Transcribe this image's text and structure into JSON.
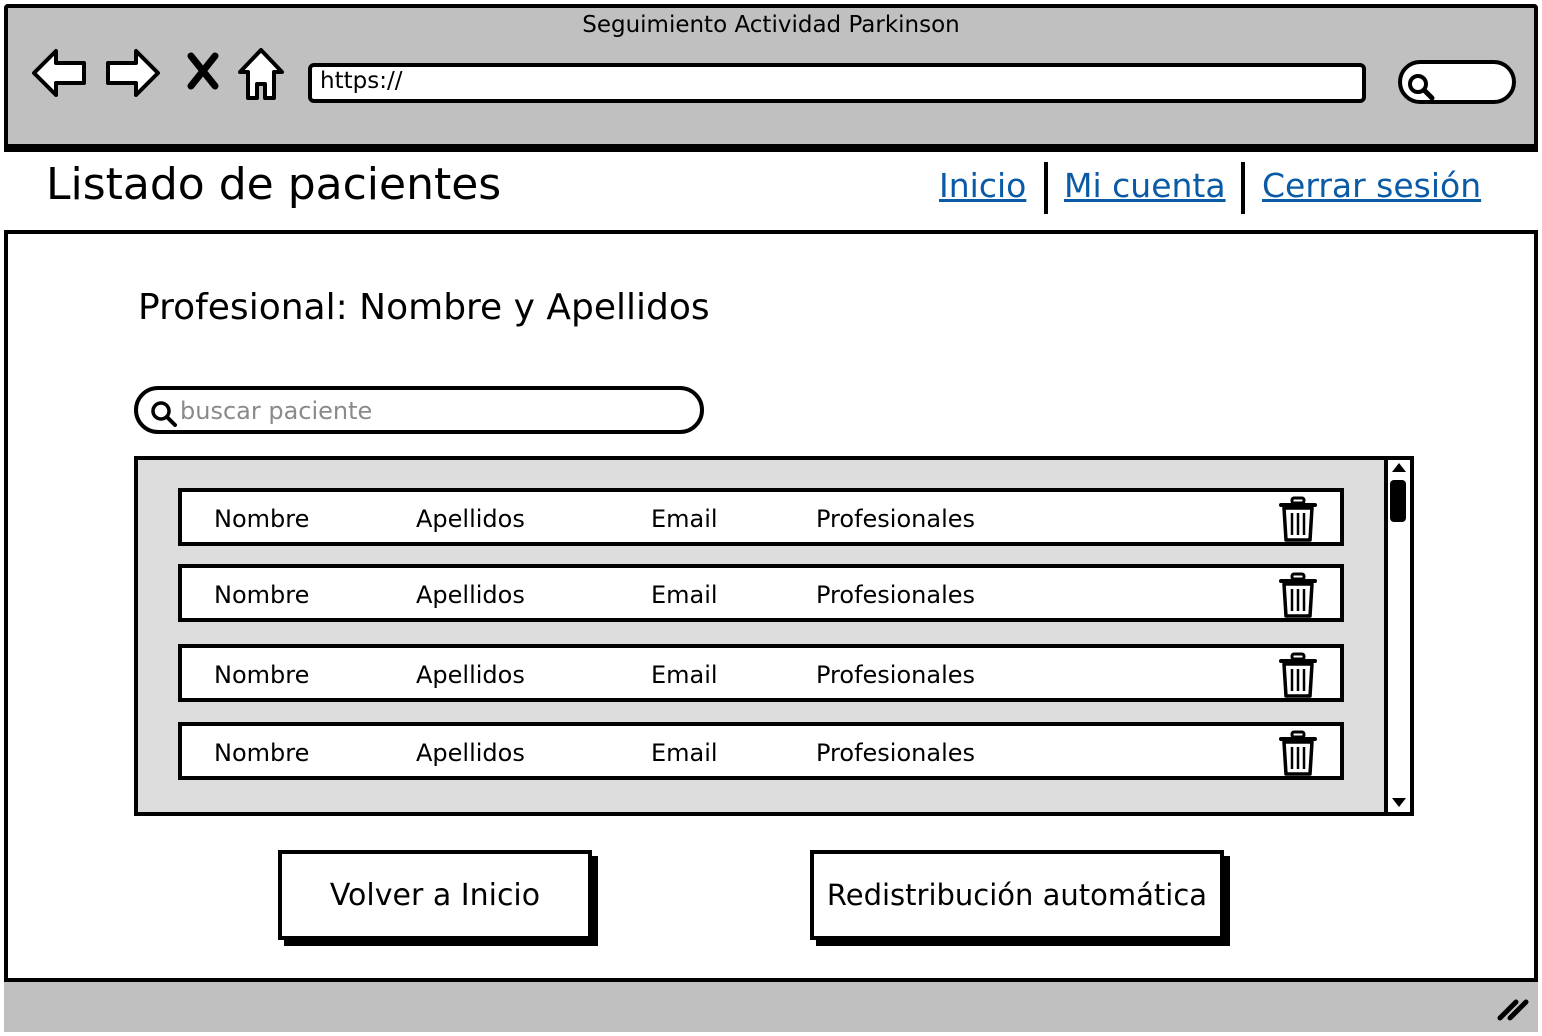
{
  "window": {
    "title": "Seguimiento Actividad Parkinson"
  },
  "browser": {
    "url": "https://",
    "nav_icons": [
      "back-arrow-icon",
      "forward-arrow-icon",
      "stop-x-icon",
      "home-icon"
    ],
    "search_icon": "search-icon"
  },
  "header": {
    "title": "Listado de pacientes",
    "links": {
      "home": "Inicio",
      "account": "Mi cuenta",
      "logout": "Cerrar sesión"
    },
    "link_color": "#0b5aa6"
  },
  "main": {
    "professional_label": "Profesional: Nombre y Apellidos",
    "search": {
      "placeholder": "buscar paciente",
      "value": ""
    },
    "patients": [
      {
        "nombre": "Nombre",
        "apellidos": "Apellidos",
        "email": "Email",
        "profesionales": "Profesionales"
      },
      {
        "nombre": "Nombre",
        "apellidos": "Apellidos",
        "email": "Email",
        "profesionales": "Profesionales"
      },
      {
        "nombre": "Nombre",
        "apellidos": "Apellidos",
        "email": "Email",
        "profesionales": "Profesionales"
      },
      {
        "nombre": "Nombre",
        "apellidos": "Apellidos",
        "email": "Email",
        "profesionales": "Profesionales"
      }
    ],
    "row_action_icon": "trash-icon"
  },
  "actions": {
    "back_label": "Volver a Inicio",
    "redistribute_label": "Redistribución automática"
  },
  "colors": {
    "chrome": "#c0c0c0",
    "list_background": "#dcdcdc"
  }
}
